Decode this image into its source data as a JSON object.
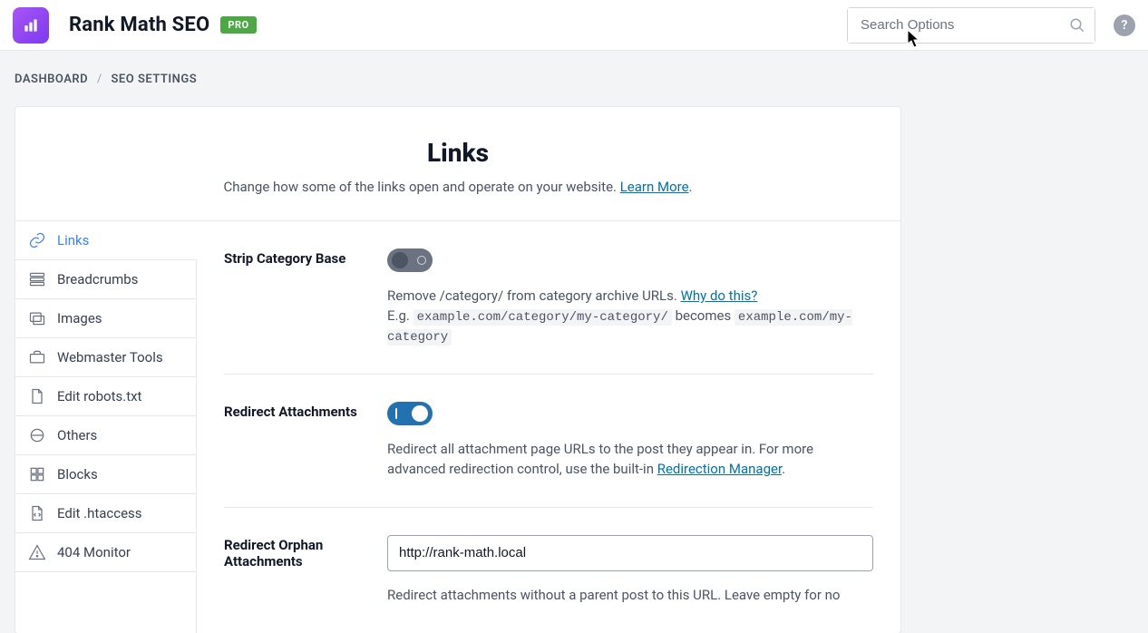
{
  "header": {
    "app_title": "Rank Math SEO",
    "badge": "PRO",
    "search_placeholder": "Search Options",
    "help_label": "?"
  },
  "breadcrumb": {
    "root": "DASHBOARD",
    "sep": "/",
    "current": "SEO SETTINGS"
  },
  "panel": {
    "title": "Links",
    "subtitle": "Change how some of the links open and operate on your website. ",
    "learn_more": "Learn More",
    "period": "."
  },
  "tabs": [
    {
      "id": "links",
      "label": "Links",
      "active": true
    },
    {
      "id": "breadcrumbs",
      "label": "Breadcrumbs",
      "active": false
    },
    {
      "id": "images",
      "label": "Images",
      "active": false
    },
    {
      "id": "wmtools",
      "label": "Webmaster Tools",
      "active": false
    },
    {
      "id": "robots",
      "label": "Edit robots.txt",
      "active": false
    },
    {
      "id": "others",
      "label": "Others",
      "active": false
    },
    {
      "id": "blocks",
      "label": "Blocks",
      "active": false
    },
    {
      "id": "htaccess",
      "label": "Edit .htaccess",
      "active": false
    },
    {
      "id": "404",
      "label": "404 Monitor",
      "active": false
    }
  ],
  "settings": {
    "strip_category": {
      "label": "Strip Category Base",
      "value": false,
      "desc_pre": "Remove /category/ from category archive URLs.",
      "link": "Why do this?",
      "eg_label": "E.g. ",
      "becomes": " becomes ",
      "code_from": "example.com/category/my-category/",
      "code_to": "example.com/my-category"
    },
    "redirect_attachments": {
      "label": "Redirect Attachments",
      "value": true,
      "desc_pre": "Redirect all attachment page URLs to the post they appear in. For more advanced redirection control, use the built-in ",
      "link": "Redirection Manager",
      "period": "."
    },
    "redirect_orphan": {
      "label": "Redirect Orphan Attachments",
      "value": "http://rank-math.local",
      "desc": "Redirect attachments without a parent post to this URL. Leave empty for no"
    }
  }
}
